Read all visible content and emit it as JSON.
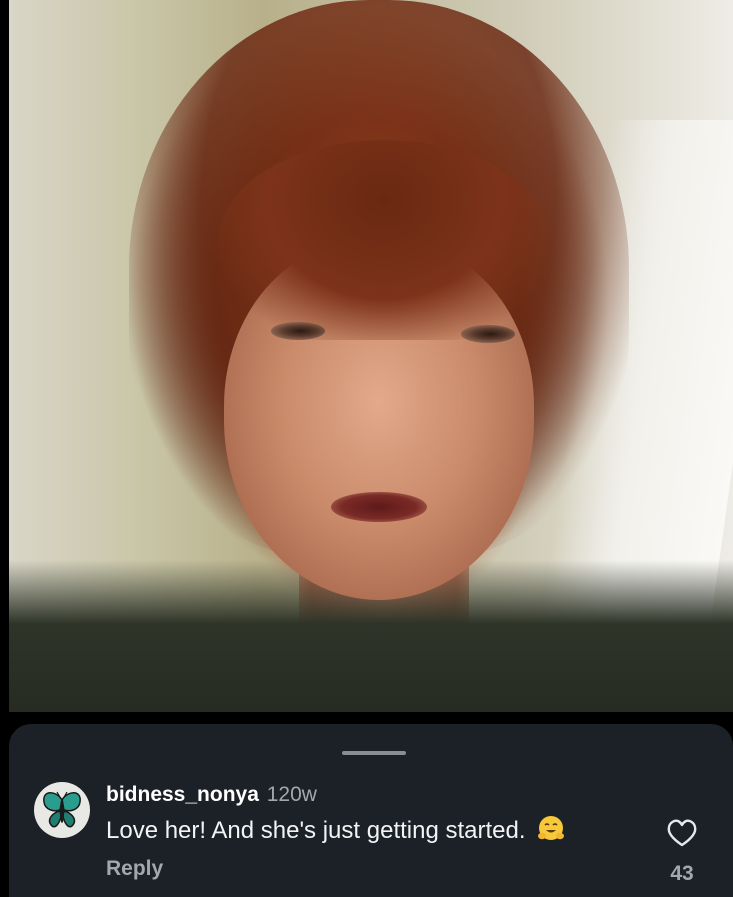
{
  "comment": {
    "username": "bidness_nonya",
    "time": "120w",
    "text": "Love her! And she's just getting started.",
    "emoji": "hugging-face-emoji",
    "reply_label": "Reply",
    "like_count": "43"
  },
  "avatar": {
    "icon": "butterfly-icon",
    "colors": {
      "wing": "#2a9d8f",
      "body": "#1a1a1a",
      "background": "#e8e8e4"
    }
  },
  "colors": {
    "sheet_background": "#1c2027",
    "secondary_text": "#a4a8ae",
    "primary_text": "#ffffff"
  }
}
